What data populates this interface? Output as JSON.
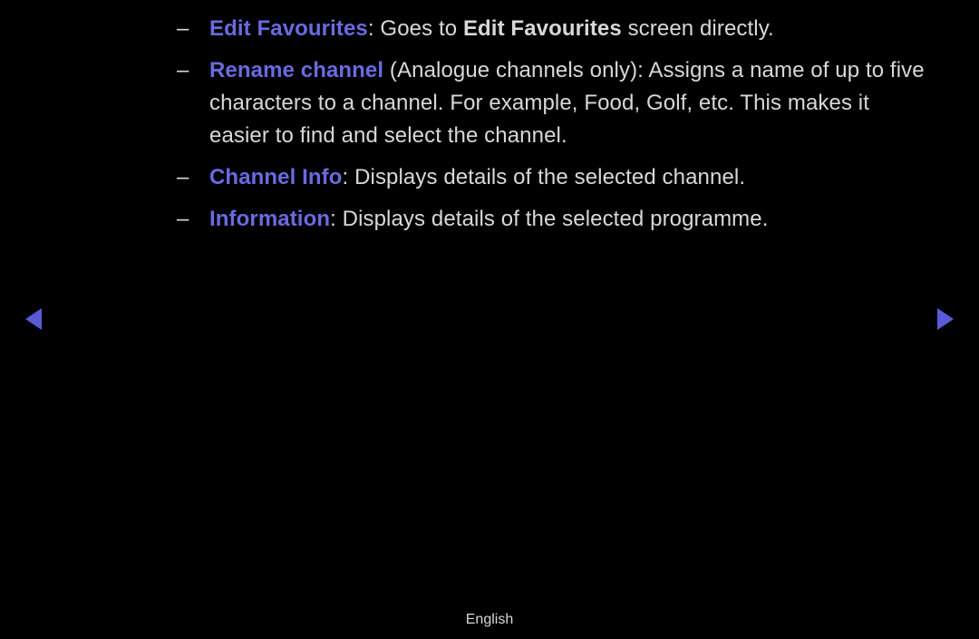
{
  "items": [
    {
      "term": "Edit Favourites",
      "sep": ": ",
      "pre": "Goes to ",
      "bold": "Edit Favourites",
      "post": " screen directly."
    },
    {
      "term": "Rename channel",
      "sep": " ",
      "pre": "(Analogue channels only): Assigns a name of up to five characters to a channel. For example, Food, Golf, etc. This makes it easier to find and select the channel.",
      "bold": "",
      "post": ""
    },
    {
      "term": "Channel Info",
      "sep": ": ",
      "pre": "Displays details of the selected channel.",
      "bold": "",
      "post": ""
    },
    {
      "term": "Information",
      "sep": ": ",
      "pre": "Displays details of the selected programme.",
      "bold": "",
      "post": ""
    }
  ],
  "dash": "–",
  "footer": {
    "lang": "English"
  }
}
